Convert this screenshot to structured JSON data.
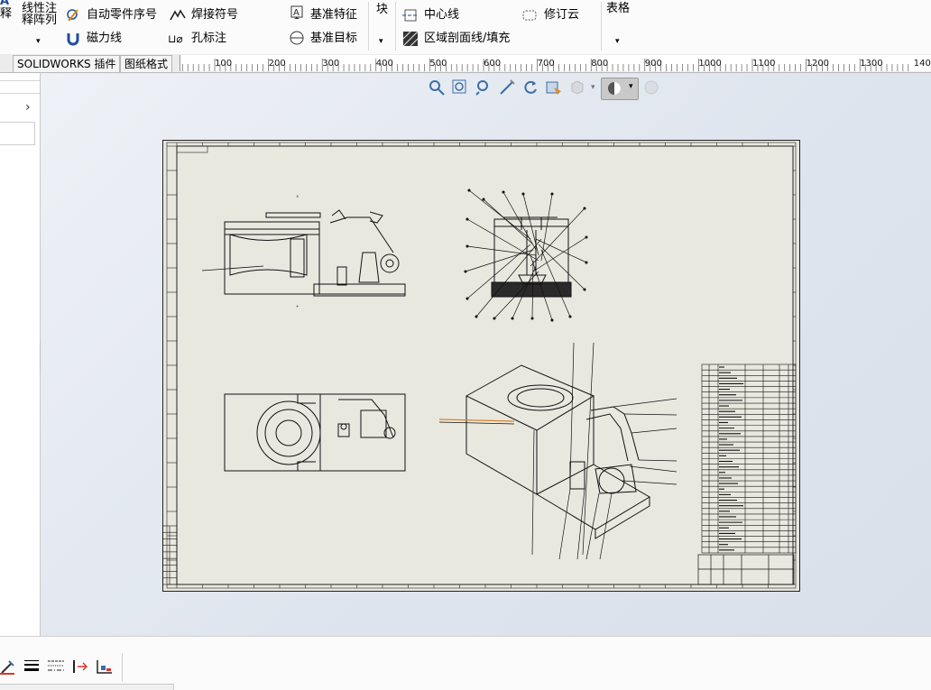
{
  "ribbon": {
    "partial_left_top": "A",
    "partial_left_bottom": "释",
    "linear_note_top": "线性注",
    "linear_note_bottom": "释阵列",
    "auto_balloon": "自动零件序号",
    "weld_symbol": "焊接符号",
    "magnetic_line": "磁力线",
    "hole_callout": "孔标注",
    "datum_feature": "基准特征",
    "datum_target": "基准目标",
    "block": "块",
    "centerline": "中心线",
    "revision_cloud": "修订云",
    "area_hatch": "区域剖面线/填充",
    "table": "表格"
  },
  "tabs": {
    "solidworks_addins": "SOLIDWORKS 插件",
    "sheet_format": "图纸格式"
  },
  "ruler": {
    "labels": [
      "100",
      "200",
      "300",
      "400",
      "500",
      "600",
      "700",
      "800",
      "900",
      "1000",
      "1100",
      "1200",
      "1300",
      "1400"
    ]
  },
  "heads_up_toolbar": {
    "icons": [
      "zoom-to-fit-icon",
      "zoom-area-icon",
      "zoom-in-out-icon",
      "pan-icon",
      "rotate-icon",
      "display-style-icon",
      "hide-show-icon",
      "view-setting-icon",
      "appearance-icon"
    ]
  },
  "colors": {
    "sheet_bg": "#e9e8df",
    "canvas_bg": "#dfe5ee",
    "highlight_leader": "#d9822b"
  }
}
